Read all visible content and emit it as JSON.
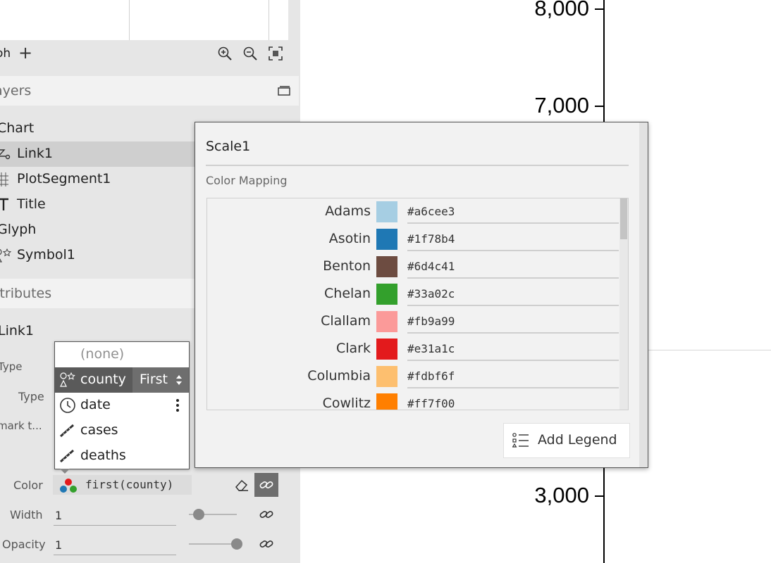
{
  "glyph_toolbar": {
    "label": "oh"
  },
  "layers": {
    "header": "ayers",
    "items": [
      {
        "label": "Chart",
        "icon": "chart"
      },
      {
        "label": "Link1",
        "icon": "link-icon"
      },
      {
        "label": "PlotSegment1",
        "icon": "grid-icon"
      },
      {
        "label": "Title",
        "icon": "text-icon"
      },
      {
        "label": "Glyph",
        "icon": "glyph"
      },
      {
        "label": "Symbol1",
        "icon": "symbol-icon"
      }
    ]
  },
  "attributes": {
    "header": "ttributes",
    "object_name": "Link1",
    "props": {
      "type1": "Type",
      "type2": "Type",
      "mark": "mark t...",
      "color": "Color",
      "width": "Width",
      "opacity": "Opacity"
    },
    "color_value": "first(county)",
    "width_value": "1",
    "opacity_value": "1",
    "width_slider_fraction": 0.2,
    "opacity_slider_fraction": 1.0
  },
  "field_dropdown": {
    "items": [
      {
        "label": "(none)",
        "icon": ""
      },
      {
        "label": "county",
        "icon": "categorical-icon",
        "aggregation": "First"
      },
      {
        "label": "date",
        "icon": "date-icon"
      },
      {
        "label": "cases",
        "icon": "numerical-icon"
      },
      {
        "label": "deaths",
        "icon": "numerical-icon"
      }
    ]
  },
  "chart": {
    "y_ticks": [
      "8,000",
      "7,000",
      "3,000"
    ],
    "axis_color": "#000000"
  },
  "scale_popup": {
    "name": "Scale1",
    "mapping_title": "Color Mapping",
    "mappings": [
      {
        "key": "Adams",
        "color": "#a6cee3"
      },
      {
        "key": "Asotin",
        "color": "#1f78b4"
      },
      {
        "key": "Benton",
        "color": "#6d4c41"
      },
      {
        "key": "Chelan",
        "color": "#33a02c"
      },
      {
        "key": "Clallam",
        "color": "#fb9a99"
      },
      {
        "key": "Clark",
        "color": "#e31a1c"
      },
      {
        "key": "Columbia",
        "color": "#fdbf6f"
      },
      {
        "key": "Cowlitz",
        "color": "#ff7f00"
      }
    ],
    "add_legend_label": "Add Legend"
  }
}
